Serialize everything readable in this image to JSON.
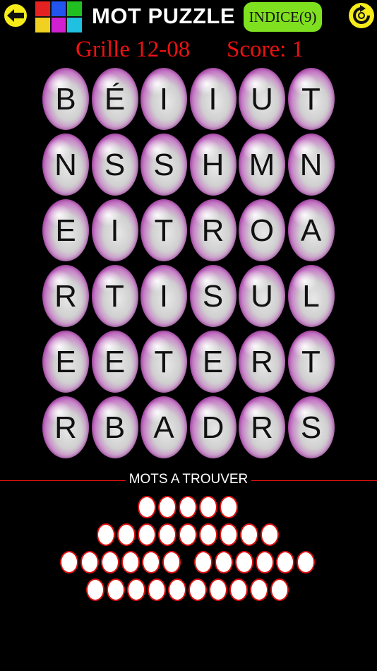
{
  "header": {
    "title": "MOT PUZZLE",
    "hint_label": "INDICE(9)",
    "logo_colors": [
      "#e52222",
      "#2255ee",
      "#20c020",
      "#f0d020",
      "#d020d0",
      "#20c0e0"
    ]
  },
  "status": {
    "grid_label": "Grille 12-08",
    "score_label": "Score: 1"
  },
  "board": {
    "rows": [
      [
        "B",
        "É",
        "I",
        "I",
        "U",
        "T"
      ],
      [
        "N",
        "S",
        "S",
        "H",
        "M",
        "N"
      ],
      [
        "E",
        "I",
        "T",
        "R",
        "O",
        "A"
      ],
      [
        "R",
        "T",
        "I",
        "S",
        "U",
        "L"
      ],
      [
        "E",
        "E",
        "T",
        "E",
        "R",
        "T"
      ],
      [
        "R",
        "B",
        "A",
        "D",
        "R",
        "S"
      ]
    ]
  },
  "words": {
    "title": "MOTS A TROUVER",
    "rows": [
      5,
      9,
      12,
      10
    ]
  },
  "colors": {
    "accent_red": "#e11111",
    "button_yellow": "#f5ec1a",
    "hint_green": "#7fe020"
  }
}
